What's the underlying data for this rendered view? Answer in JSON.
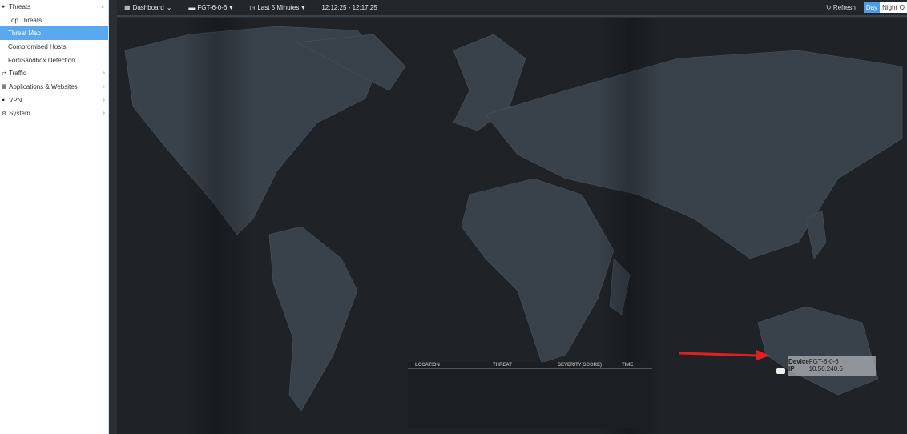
{
  "sidebar": {
    "threats": "Threats",
    "sub": [
      "Top Threats",
      "Threat Map",
      "Compromised Hosts",
      "FortiSandbox Detection"
    ],
    "groups": [
      "Traffic",
      "Applications & Websites",
      "VPN",
      "System"
    ]
  },
  "toolbar": {
    "dashboard": "Dashboard",
    "device": "FGT-6-0-6",
    "range": "Last 5 Minutes",
    "time": "12:12:25 - 12:17:25",
    "refresh": "Refresh",
    "day": "Day",
    "night": "Night",
    "o": "O"
  },
  "table": {
    "headers": [
      "LOCATION",
      "THREAT",
      "SEVERITY(SCORE)",
      "TIME"
    ]
  },
  "tooltip": {
    "device_label": "Device",
    "device": "FGT-6-0-6",
    "ip_label": "IP",
    "ip": "10.56.240.6"
  }
}
